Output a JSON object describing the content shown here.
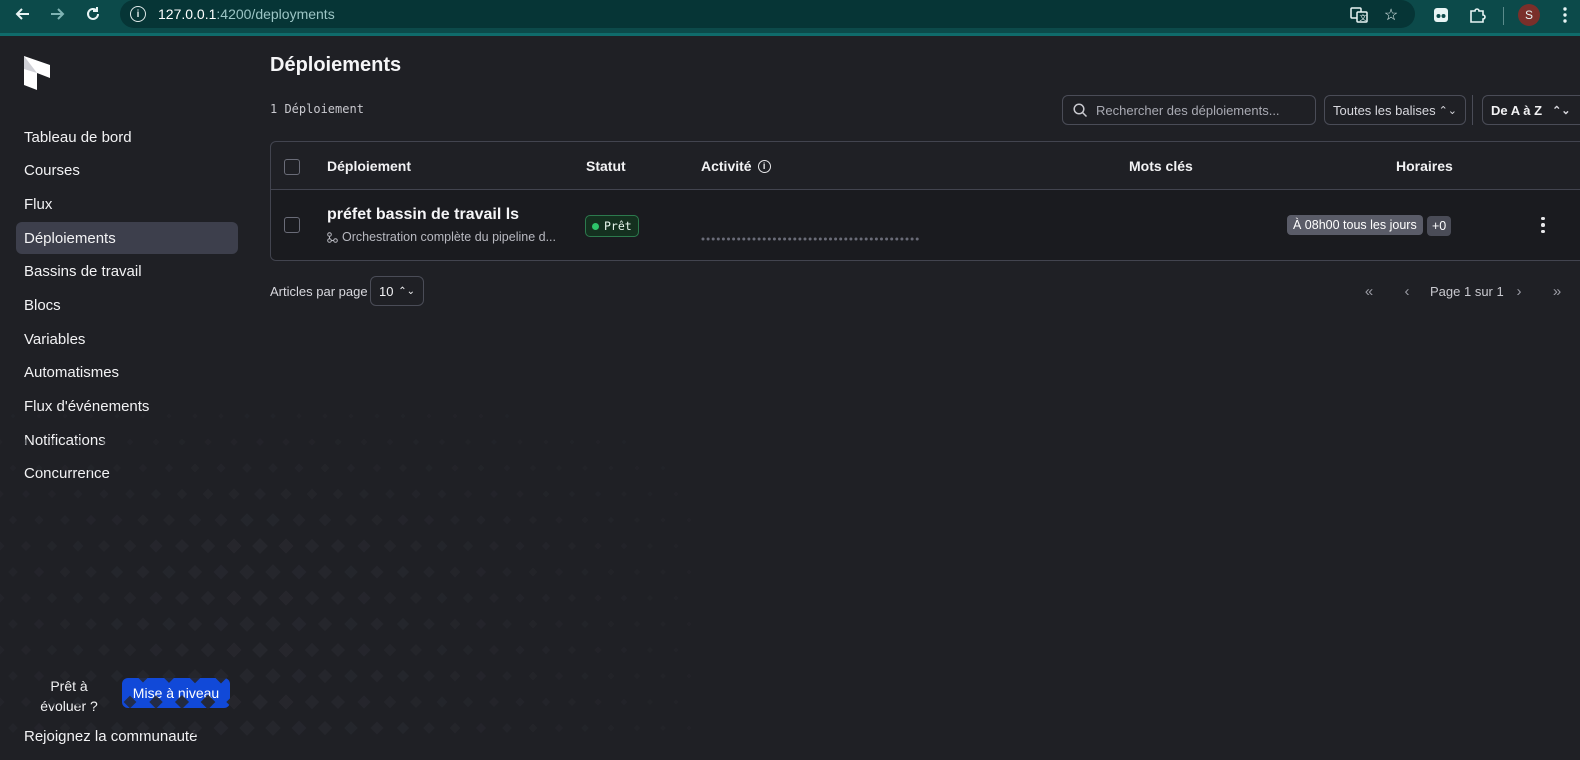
{
  "browser": {
    "url_host": "127.0.0.1",
    "url_path": ":4200/deployments",
    "avatar_letter": "S"
  },
  "sidebar": {
    "items": [
      {
        "label": "Tableau de bord"
      },
      {
        "label": "Courses"
      },
      {
        "label": "Flux"
      },
      {
        "label": "Déploiements",
        "active": true
      },
      {
        "label": "Bassins de travail"
      },
      {
        "label": "Blocs"
      },
      {
        "label": "Variables"
      },
      {
        "label": "Automatismes"
      },
      {
        "label": "Flux d'événements"
      },
      {
        "label": "Notifications"
      },
      {
        "label": "Concurrence"
      }
    ],
    "upgrade_text": "Prêt à évoluer ?",
    "upgrade_button": "Mise à niveau",
    "community": "Rejoignez la communauté"
  },
  "main": {
    "title": "Déploiements",
    "count": "1 Déploiement",
    "search_placeholder": "Rechercher des déploiements...",
    "tags_filter": "Toutes les balises",
    "sort": "De A à Z",
    "columns": {
      "deployment": "Déploiement",
      "status": "Statut",
      "activity": "Activité",
      "tags": "Mots clés",
      "schedules": "Horaires"
    },
    "rows": [
      {
        "name": "préfet bassin de travail ls",
        "flow": "Orchestration complète du pipeline d...",
        "status": "Prêt",
        "schedule": "À 08h00 tous les jours",
        "more": "+0"
      }
    ],
    "per_page_label": "Articles par page",
    "per_page_value": "10",
    "page_info": "Page 1 sur 1"
  },
  "colors": {
    "background": "#1f2025",
    "accent": "#1149d8",
    "status_ready": "#2dc46a",
    "active_nav": "#3d3f4c"
  }
}
